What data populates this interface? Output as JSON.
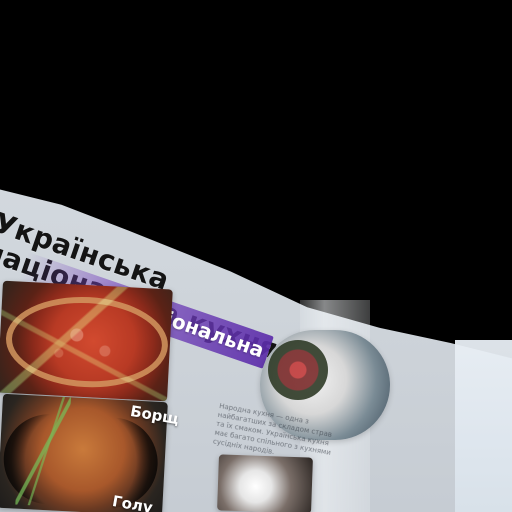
{
  "title": {
    "line1": "Українська",
    "line2": "національна кухня"
  },
  "captions": {
    "borsch": "Борщ",
    "holubtsi": "Голу"
  },
  "body_text": "Народна кухня — одна з найбагатших за складом страв та їх смаком. Українська кухня має багато спільного з кухнями сусідніх народів."
}
